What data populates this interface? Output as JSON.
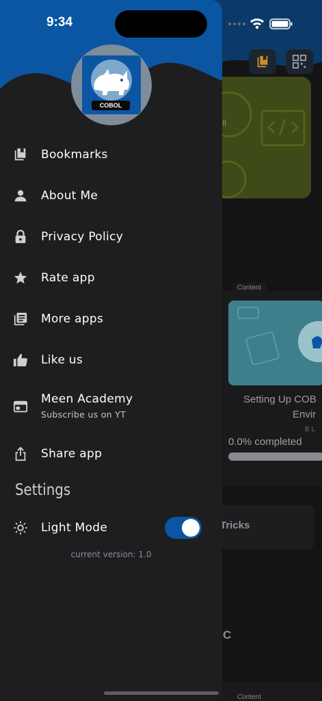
{
  "status_bar": {
    "time": "9:34"
  },
  "drawer": {
    "avatar_badge": "COBOL",
    "menu": [
      {
        "label": "Bookmarks"
      },
      {
        "label": "About Me"
      },
      {
        "label": "Privacy Policy"
      },
      {
        "label": "Rate app"
      },
      {
        "label": "More apps"
      },
      {
        "label": "Like us"
      },
      {
        "label": "Meen Academy",
        "sublabel": "Subscribe us on YT"
      },
      {
        "label": "Share app"
      }
    ],
    "settings_heading": "Settings",
    "light_mode": {
      "label": "Light Mode",
      "enabled": true
    },
    "version": "current version: 1.0"
  },
  "background": {
    "banner_text": "all",
    "content_tag": "Content",
    "card_title": "Setting Up COB",
    "card_subtitle": "Envir",
    "card_meta": "B L",
    "progress_text": "0.0% completed",
    "progress_value": 0.0,
    "tips_text": "Tricks",
    "letter": "C",
    "content_tag_2": "Content"
  },
  "colors": {
    "accent": "#0b56a3",
    "drawer_bg": "#1e1e21",
    "header_wave": "#0b56a3",
    "text": "#ffffff"
  }
}
